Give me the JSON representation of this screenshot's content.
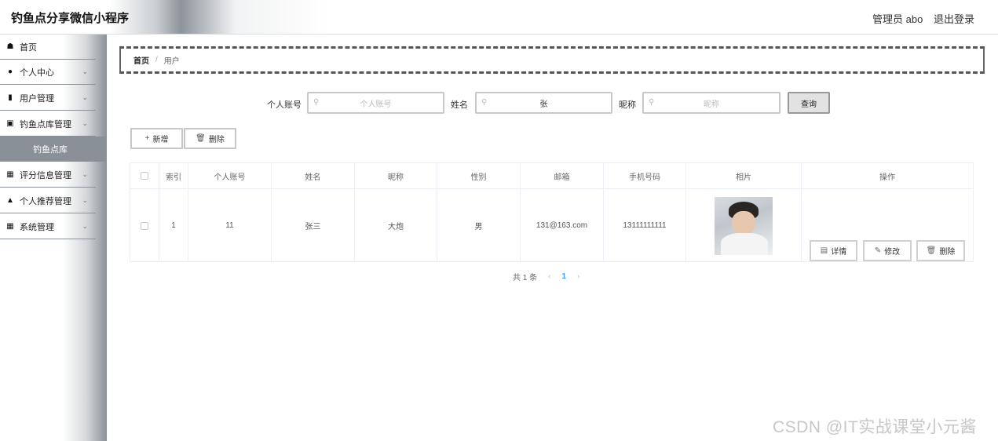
{
  "header": {
    "app_title": "钓鱼点分享微信小程序",
    "admin_user": "管理员 abo",
    "logout": "退出登录"
  },
  "sidebar": {
    "items": [
      {
        "label": "首页",
        "icon": "home-icon"
      },
      {
        "label": "个人中心",
        "icon": "person-icon"
      },
      {
        "label": "用户管理",
        "icon": "user-manage-icon"
      },
      {
        "label": "钓鱼点库管理",
        "icon": "monitor-icon"
      },
      {
        "label": "评分信息管理",
        "icon": "grid-icon"
      },
      {
        "label": "个人推荐管理",
        "icon": "person-up-icon"
      },
      {
        "label": "系统管理",
        "icon": "grid-icon"
      }
    ],
    "sub_item": "钓鱼点库"
  },
  "breadcrumb": {
    "home": "首页",
    "separator": "/",
    "current": "用户"
  },
  "search": {
    "account_label": "个人账号",
    "account_placeholder": "个人账号",
    "name_label": "姓名",
    "name_value": "张",
    "nickname_label": "昵称",
    "nickname_placeholder": "昵称",
    "query_button": "查询"
  },
  "toolbar": {
    "add_label": "新增",
    "delete_label": "删除"
  },
  "table": {
    "headers": [
      "索引",
      "个人账号",
      "姓名",
      "昵称",
      "性别",
      "邮箱",
      "手机号码",
      "相片",
      "操作"
    ],
    "rows": [
      {
        "index": "1",
        "account": "11",
        "name": "张三",
        "nickname": "大炮",
        "gender": "男",
        "email": "131@163.com",
        "phone": "13111111111"
      }
    ],
    "actions": {
      "detail": "详情",
      "edit": "修改",
      "delete": "删除"
    }
  },
  "pagination": {
    "total": "共 1 条",
    "current_page": "1"
  },
  "watermark": "CSDN @IT实战课堂小元酱",
  "colors": {
    "sidebar_active": "#8a9098",
    "page_accent": "#409eff"
  }
}
